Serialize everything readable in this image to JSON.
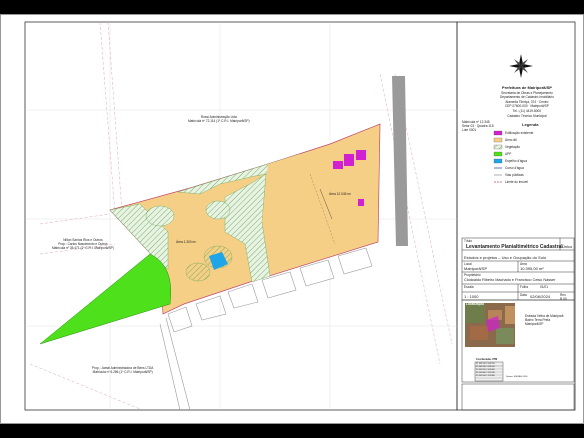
{
  "north_arrow": "north-arrow-icon",
  "header_block": {
    "lines": [
      "Prefeitura de Mairiporã/SP",
      "Secretaria de Obras e Planejamento",
      "Departamento de Cadastro Imobiliário",
      "Alameda Tibiriçá, 374 · Centro",
      "CEP 07600-000 · Mairiporã/SP",
      "Tel.: (11) 4419-8000",
      "Cadastro Técnico Municipal"
    ],
    "small_lines": [
      "Matrícula nº 12.345",
      "Setor 03 · Quadra 118",
      "Lote 0001"
    ]
  },
  "legend": {
    "title": "Legenda",
    "items": [
      {
        "label": "Edificação existente",
        "color": "#d020d0"
      },
      {
        "label": "Área útil",
        "color": "#f7cf86"
      },
      {
        "label": "Vegetação",
        "color": "#cfe7c4"
      },
      {
        "label": "APP",
        "color": "#55dd22"
      },
      {
        "label": "Espelho d'água",
        "color": "#22a8e6"
      },
      {
        "label": "Curso d'água",
        "color": "#3355aa"
      },
      {
        "label": "Vias públicas",
        "color": "#9a9a9a"
      },
      {
        "label": "Limite do imóvel",
        "color": "#cc4466"
      }
    ]
  },
  "map_labels": {
    "north_neighbor": [
      "Rossi Administração Ltda",
      "Matrícula nº 72.114 (1º C.R.I. Mairiporã/SP)"
    ],
    "west_neighbor": [
      "Nilton Santos Rios e Outros",
      "Prop.: Carlos Nascimento e Outros",
      "Matrícula nº 35.471 (1º C.R.I. Mairiporã/SP)"
    ],
    "south_neighbor": [
      "Prop.: Jamal Administradora de Bens LTDA",
      "Matrícula nº 6.286 (1º C.R.I. Mairiporã/SP)"
    ],
    "area_1": "Área 1.300 m²",
    "area_2": "Área 12.045 m²"
  },
  "title_block": {
    "main_title": "Levantamento Planialtimétrico Cadastral",
    "unit_label": "Único",
    "subtitle_label": "Título",
    "subtitle": "Estudos e projetos – Uso e Ocupação do Solo",
    "local_label": "Local",
    "local": "Mairiporã/SP",
    "area_label": "Área",
    "area": "10.395,00 m²",
    "owner_label": "Proprietário",
    "owner": "Clodoaldo Ribeiro Machado e Francisco Celso Nasser",
    "scale_label": "Escala",
    "scale": "1 : 1000",
    "sheet_label": "Folha",
    "sheet": "01/01",
    "date_label": "Data",
    "date": "02/06/2024",
    "revision_label": "Rev.",
    "revision": "R.00"
  },
  "location_block": {
    "label": "Localização",
    "caption_lines": [
      "Estrada Velha de Mairiporã",
      "Bairro Terra Preta",
      "Mairiporã/SP"
    ],
    "table_title": "Coordenadas UTM",
    "table_rows": [
      [
        "P1",
        "343.120",
        "7.416.210"
      ],
      [
        "P2",
        "343.310",
        "7.416.245"
      ],
      [
        "P3",
        "343.355",
        "7.416.060"
      ],
      [
        "P4",
        "343.080",
        "7.415.940"
      ],
      [
        "P5",
        "342.960",
        "7.415.880"
      ]
    ],
    "table_note": "Datum: SIRGAS 2000"
  },
  "colors": {
    "parcel_fill": "#f6cf86",
    "vegetation_fill": "#c8e3bf",
    "app_fill": "#4ee01a",
    "water_fill": "#1ea6e8",
    "building_fill": "#d11fd1",
    "road_gray": "#9a9a9a",
    "boundary_line": "#c04a6a",
    "sheet_border": "#333333"
  },
  "map_icons": [
    "compass-rose-icon"
  ]
}
